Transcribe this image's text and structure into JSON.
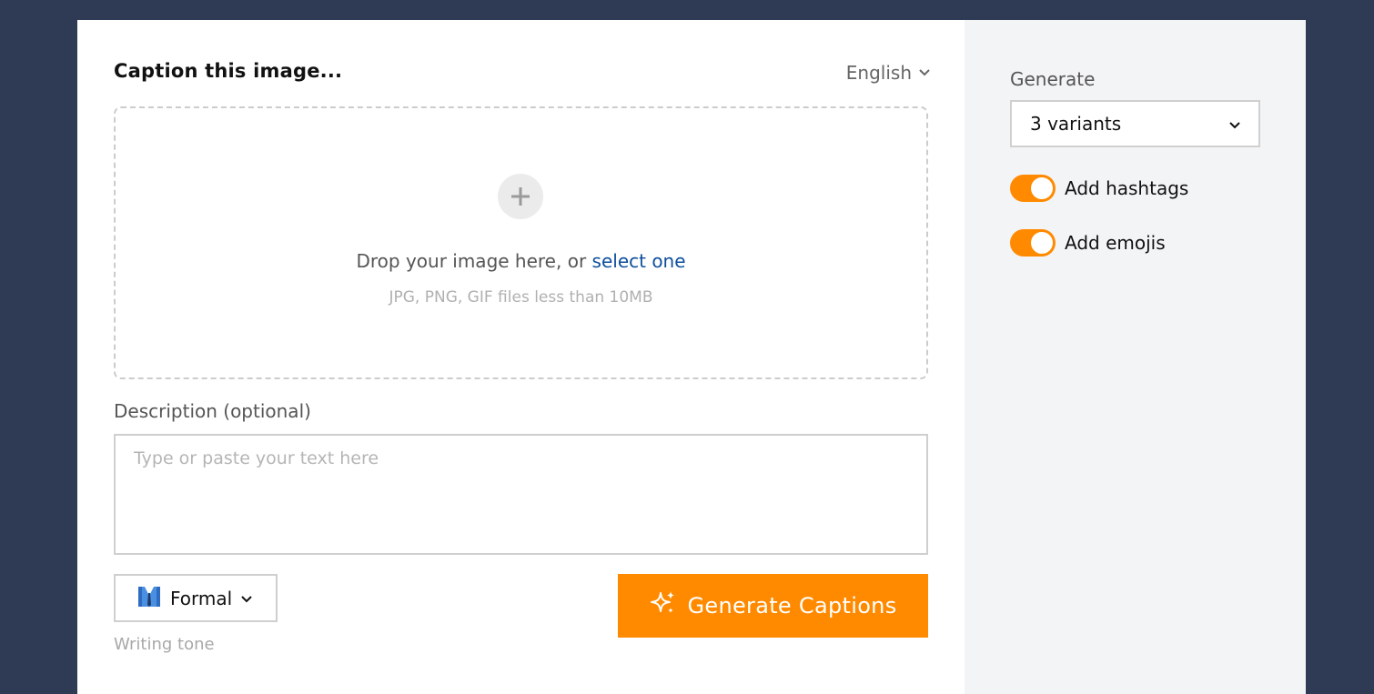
{
  "main": {
    "title": "Caption this image...",
    "language": "English",
    "dropzone": {
      "text": "Drop your image here, or ",
      "link": "select one",
      "hint": "JPG, PNG, GIF files less than 10MB"
    },
    "description": {
      "label": "Description (optional)",
      "placeholder": "Type or paste your text here",
      "value": ""
    },
    "tone": {
      "selected": "Formal",
      "icon": "suit-icon",
      "caption": "Writing tone"
    },
    "generate_button": "Generate Captions"
  },
  "side": {
    "generate_label": "Generate",
    "variants_selected": "3 variants",
    "toggles": [
      {
        "label": "Add hashtags",
        "on": true
      },
      {
        "label": "Add emojis",
        "on": true
      }
    ]
  },
  "colors": {
    "background": "#2f3b54",
    "accent": "#ff8a00",
    "link": "#0d4f9c",
    "side_panel": "#f3f4f6"
  }
}
